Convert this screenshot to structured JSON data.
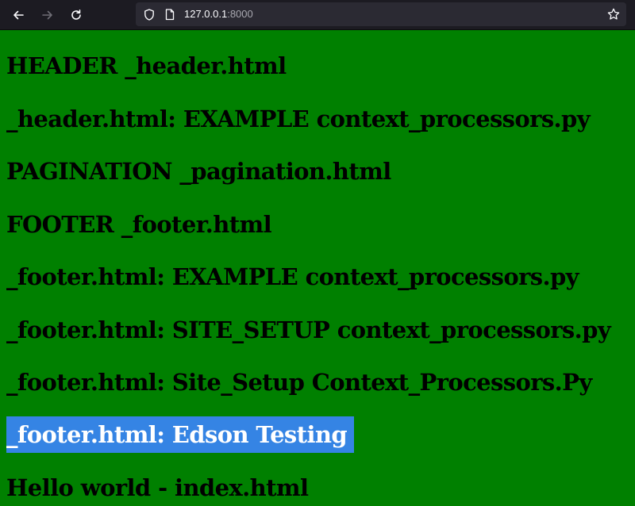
{
  "browser": {
    "url_host": "127.0.0.1",
    "url_port": ":8000",
    "icons": {
      "back": "arrow-left-icon",
      "forward": "arrow-right-icon",
      "reload": "reload-icon",
      "tracking_protection": "shield-icon",
      "page": "page-icon",
      "bookmark": "star-icon"
    }
  },
  "page": {
    "background_color": "#008000",
    "selection_color": "#3584e4",
    "lines": [
      "HEADER _header.html",
      "_header.html: EXAMPLE context_processors.py",
      "PAGINATION _pagination.html",
      "FOOTER _footer.html",
      "_footer.html: EXAMPLE context_processors.py",
      "_footer.html: SITE_SETUP context_processors.py",
      "_footer.html: Site_Setup Context_Processors.Py",
      "_footer.html: Edson Testing",
      "Hello world - index.html"
    ]
  }
}
